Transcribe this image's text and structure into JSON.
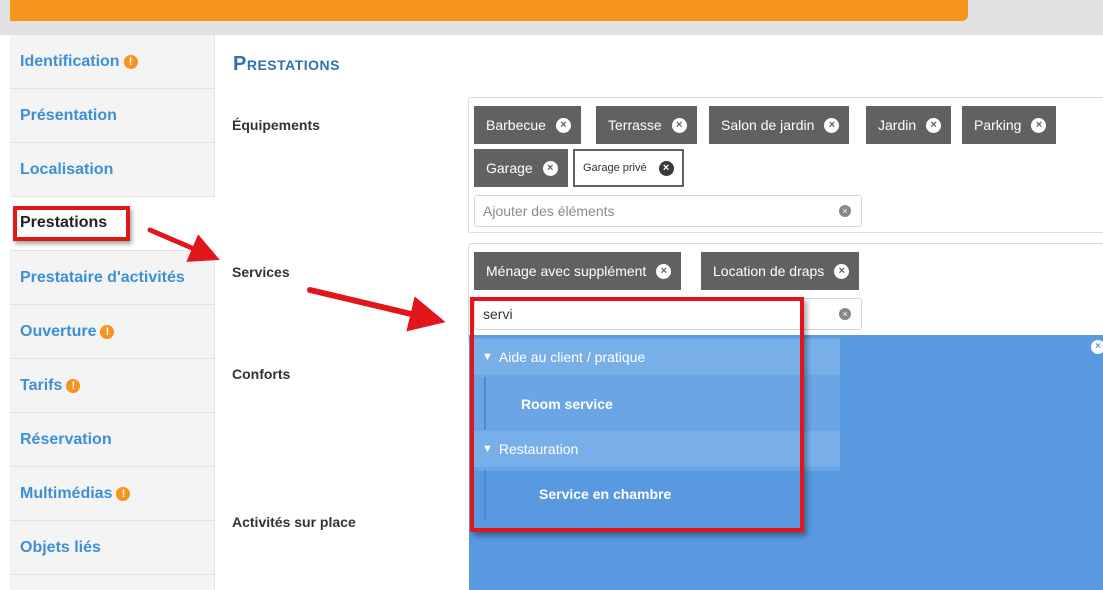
{
  "sidebar": {
    "items": [
      {
        "label": "Identification",
        "warn": true
      },
      {
        "label": "Présentation",
        "warn": false
      },
      {
        "label": "Localisation",
        "warn": false
      },
      {
        "label": "Prestations",
        "warn": false,
        "active": true
      },
      {
        "label": "Prestataire d'activités",
        "warn": false
      },
      {
        "label": "Ouverture",
        "warn": true
      },
      {
        "label": "Tarifs",
        "warn": true
      },
      {
        "label": "Réservation",
        "warn": false
      },
      {
        "label": "Multimédias",
        "warn": true
      },
      {
        "label": "Objets liés",
        "warn": false
      }
    ],
    "warn_glyph": "!"
  },
  "main": {
    "title": "Prestations",
    "fields": {
      "equipements": {
        "label": "Équipements",
        "tags": [
          "Barbecue",
          "Terrasse",
          "Salon de jardin",
          "Jardin",
          "Parking",
          "Garage",
          "Garage privé"
        ],
        "placeholder": "Ajouter des éléments"
      },
      "services": {
        "label": "Services",
        "tags": [
          "Ménage avec supplément",
          "Location de draps"
        ],
        "value": "servi"
      },
      "conforts": {
        "label": "Conforts"
      },
      "activites": {
        "label": "Activités sur place"
      }
    },
    "dropdown": {
      "groups": [
        {
          "label": "Aide au client / pratique",
          "items": [
            "Room service"
          ]
        },
        {
          "label": "Restauration",
          "items": [
            "Service en chambre"
          ]
        }
      ]
    }
  },
  "icons": {
    "remove": "×",
    "chevron": "▼"
  },
  "colors": {
    "accent_orange": "#f7941d",
    "link_blue": "#3d8fd6",
    "title_blue": "#2f6fb5",
    "tag_gray": "#616161",
    "dropdown_blue": "#5899e0",
    "highlight_red": "#e0161b"
  }
}
